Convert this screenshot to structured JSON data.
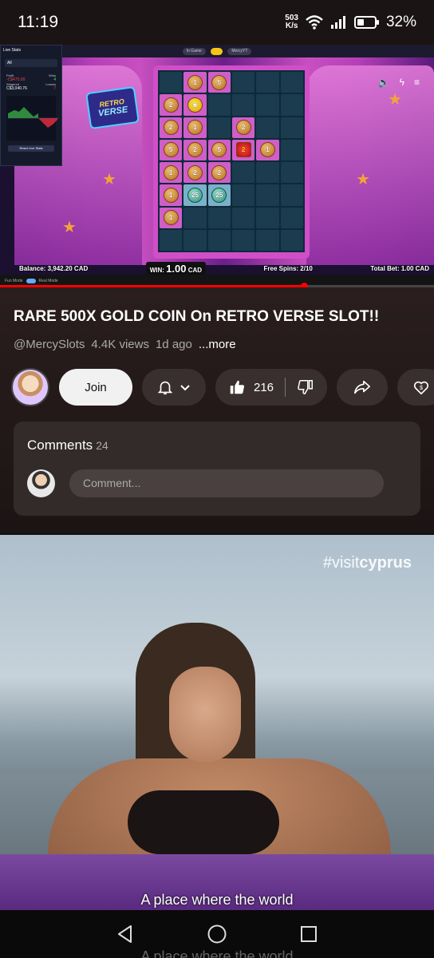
{
  "status_bar": {
    "time": "11:19",
    "net_speed_value": "503",
    "net_speed_unit": "K/s",
    "battery": "32%"
  },
  "video": {
    "game_logo_line1": "RETRO",
    "game_logo_line2": "VERSE",
    "balance": "Balance: 3,942.20 CAD",
    "win_label": "WIN:",
    "win_value": "1.00",
    "win_currency": "CAD",
    "free_spins": "Free Spins: 2/10",
    "total_bet": "Total Bet: 1.00 CAD",
    "progress": 0.7,
    "mode_left": "Fun Mode",
    "mode_right": "Real Mode",
    "top_pill_left": "In Game",
    "top_pill_user": "MercyYT",
    "live_stats": {
      "title": "Live Stats",
      "filter": "All",
      "profit_label": "Profit",
      "profit_value": "-C$475.00",
      "wins_label": "Wins",
      "wins_value": "4",
      "wagered_label": "Wagered",
      "wagered_value": "C$3,040.76",
      "losses_label": "Losses",
      "losses_value": "7",
      "reset_label": "Reset Live Stats"
    },
    "grid": [
      [
        "",
        "1",
        "5",
        "",
        "",
        ""
      ],
      [
        "2",
        "face",
        "",
        "",
        "",
        ""
      ],
      [
        "2",
        "1",
        "",
        "2",
        "",
        ""
      ],
      [
        "5",
        "2",
        "5",
        "star",
        "1",
        ""
      ],
      [
        "1",
        "2",
        "2",
        "",
        "",
        ""
      ],
      [
        "1",
        "25",
        "25",
        "",
        "",
        ""
      ],
      [
        "1",
        "",
        "",
        "",
        "",
        ""
      ],
      [
        "",
        "",
        "",
        "",
        "",
        ""
      ]
    ]
  },
  "info": {
    "title": "RARE 500X GOLD COIN On RETRO VERSE SLOT!!",
    "channel": "@MercySlots",
    "views": "4.4K views",
    "age": "1d ago",
    "more": "...more",
    "join_label": "Join",
    "like_count": "216"
  },
  "comments": {
    "heading": "Comments",
    "count": "24",
    "placeholder": "Comment..."
  },
  "ad": {
    "hashtag_prefix": "#visit",
    "hashtag_brand": "cyprus",
    "subtitle": "A place where the world"
  },
  "nav_ghost_text": "A place where the world",
  "colors": {
    "accent": "#ff0000",
    "background": "#0f0f0f",
    "card": "#332a2a"
  }
}
